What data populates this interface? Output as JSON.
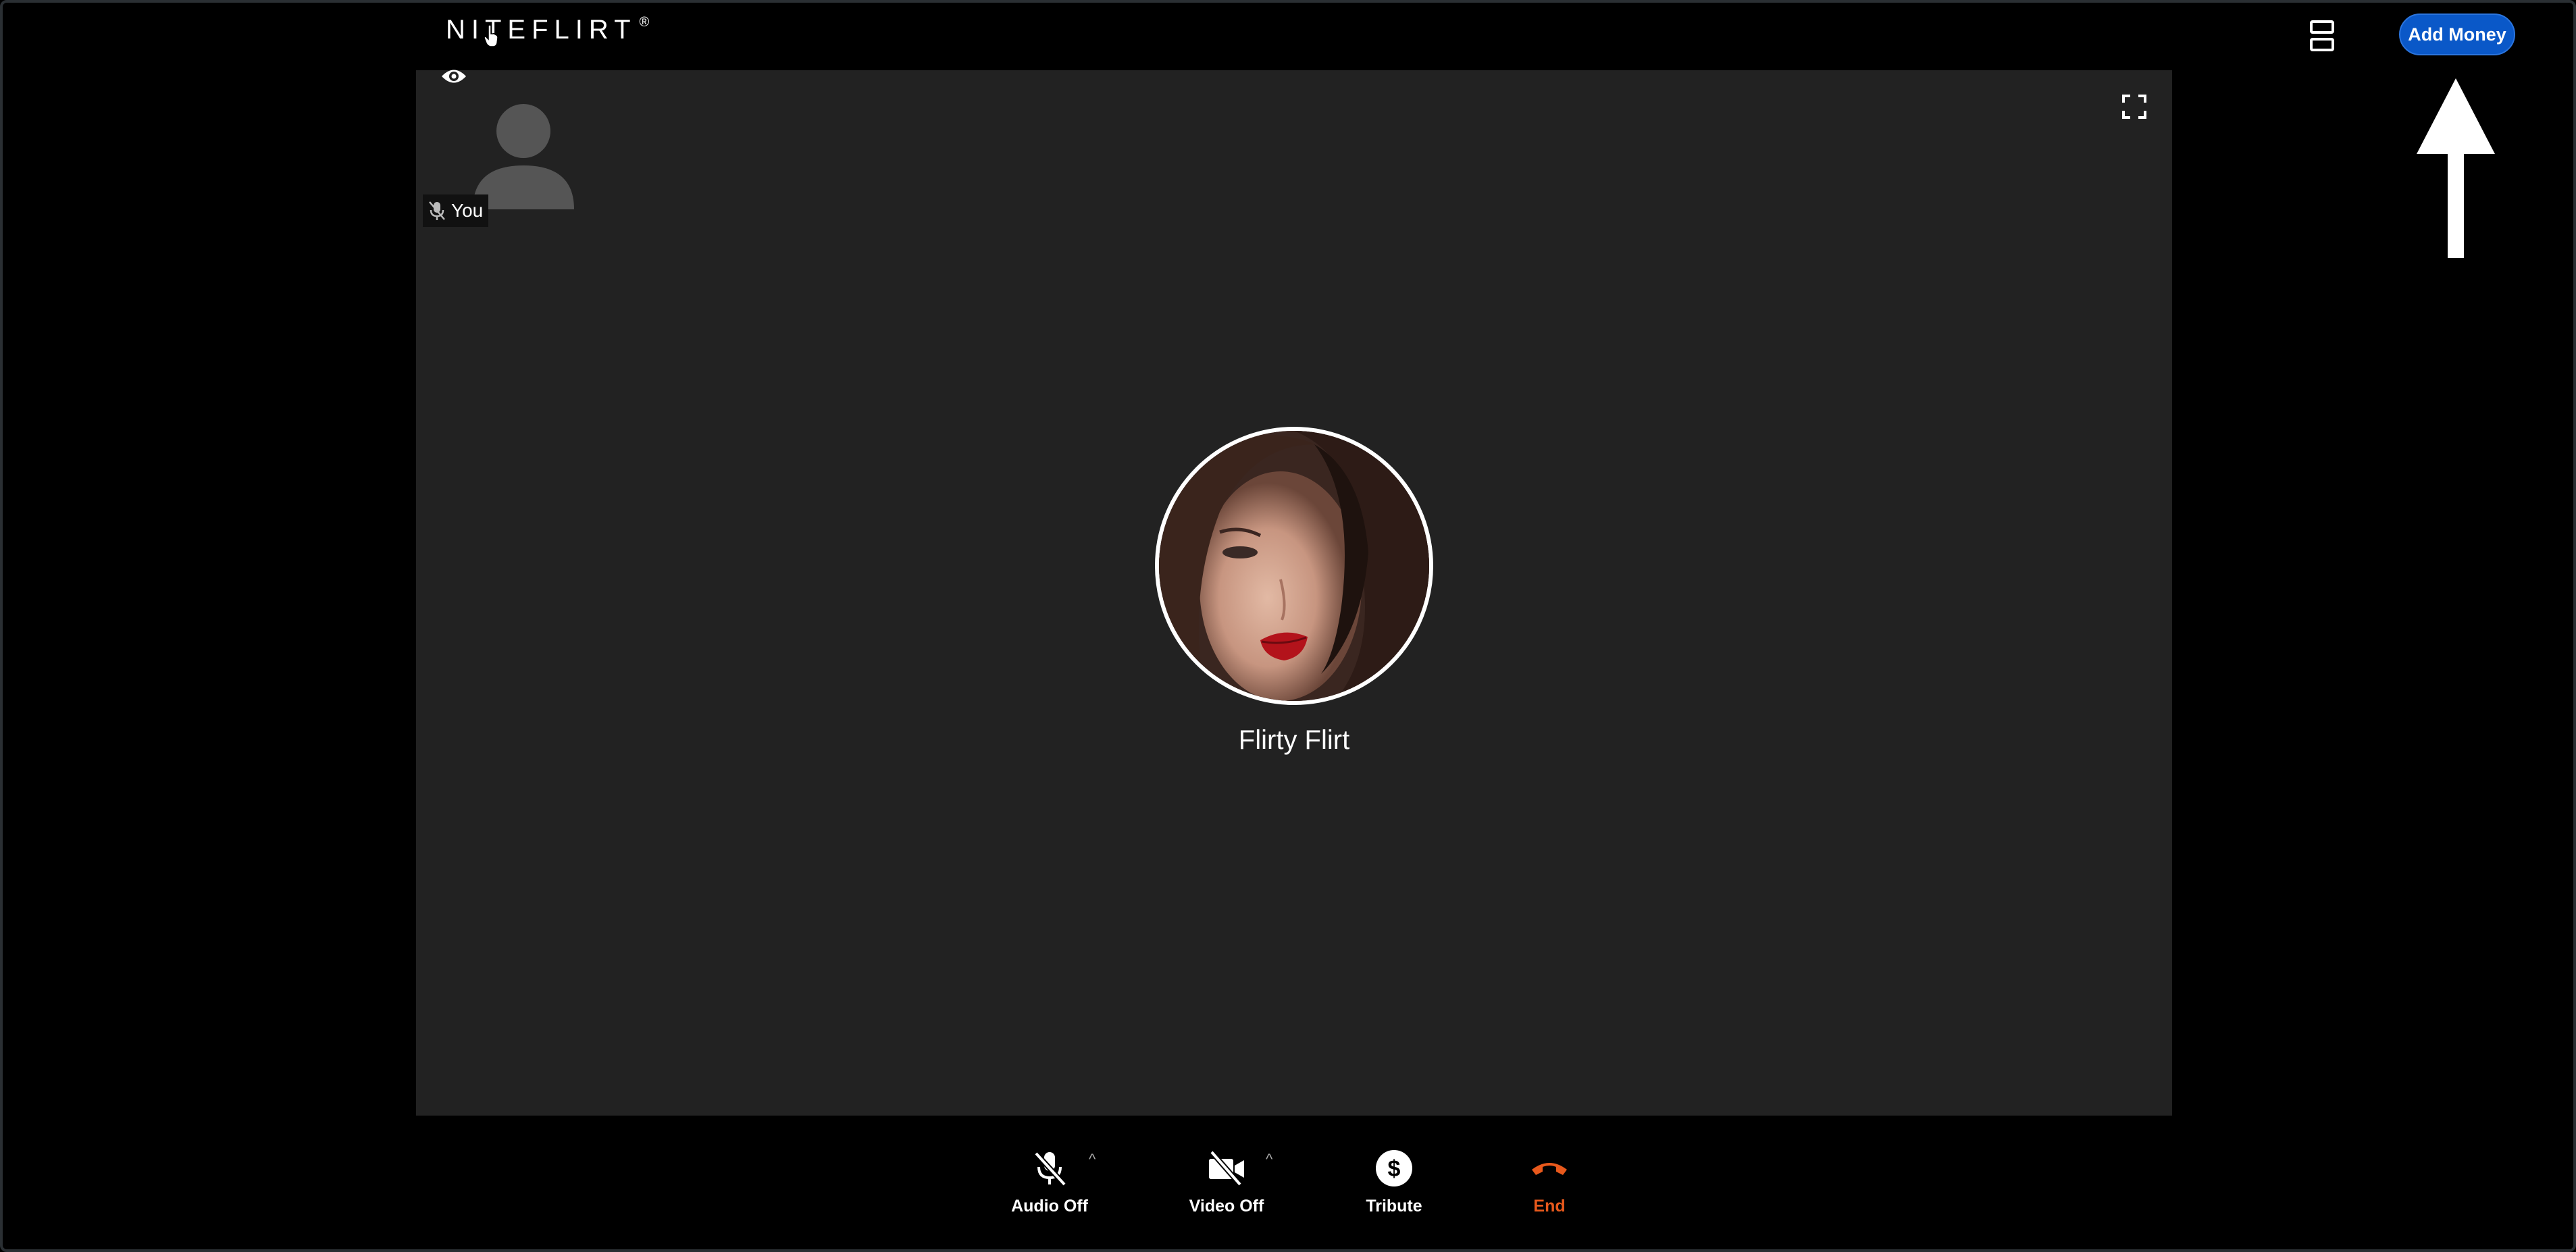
{
  "header": {
    "logo_text": "NITEFLIRT",
    "logo_mark": "®",
    "add_money_label": "Add Money"
  },
  "self_view": {
    "label": "You",
    "mic_state_icon": "mic-off-icon"
  },
  "remote": {
    "name": "Flirty Flirt"
  },
  "controls": {
    "audio_label": "Audio Off",
    "video_label": "Video Off",
    "tribute_label": "Tribute",
    "end_label": "End",
    "caret": "^"
  },
  "colors": {
    "accent": "#0a58c8",
    "end": "#e8591c",
    "stage": "#222222",
    "background": "#000000"
  }
}
